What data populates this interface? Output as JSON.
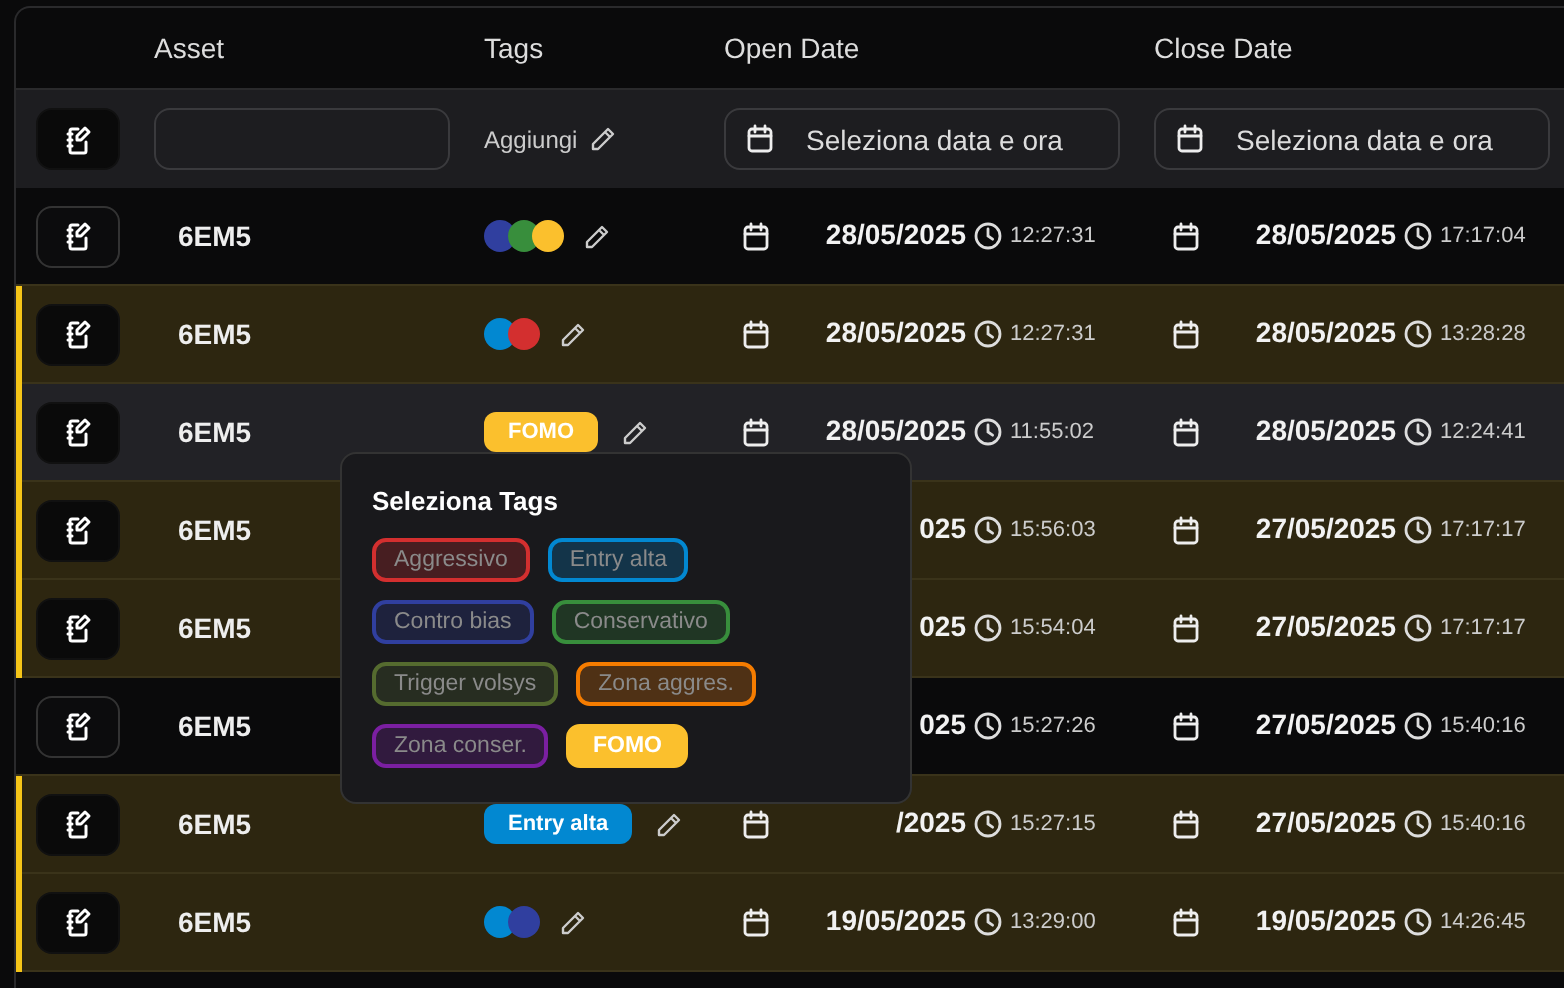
{
  "columns": [
    "Asset",
    "Tags",
    "Open Date",
    "Close Date"
  ],
  "filters": {
    "tags_label": "Aggiungi",
    "open_placeholder": "Seleziona data e ora",
    "close_placeholder": "Seleziona data e ora"
  },
  "rows": [
    {
      "asset": "6EM5",
      "highlighted": false,
      "hovered": false,
      "tags": [
        {
          "kind": "dot",
          "color": "#303f9f"
        },
        {
          "kind": "dot",
          "color": "#388e3c"
        },
        {
          "kind": "dot",
          "color": "#fbc02d"
        }
      ],
      "open_date": "28/05/2025",
      "open_time": "12:27:31",
      "close_date": "28/05/2025",
      "close_time": "17:17:04"
    },
    {
      "asset": "6EM5",
      "highlighted": true,
      "hovered": false,
      "tags": [
        {
          "kind": "dot",
          "color": "#0288d1"
        },
        {
          "kind": "dot",
          "color": "#d32f2f"
        }
      ],
      "open_date": "28/05/2025",
      "open_time": "12:27:31",
      "close_date": "28/05/2025",
      "close_time": "13:28:28"
    },
    {
      "asset": "6EM5",
      "highlighted": true,
      "hovered": true,
      "tags": [
        {
          "kind": "chip",
          "label": "FOMO",
          "color": "#fbc02d"
        }
      ],
      "open_date": "28/05/2025",
      "open_time": "11:55:02",
      "close_date": "28/05/2025",
      "close_time": "12:24:41"
    },
    {
      "asset": "6EM5",
      "highlighted": true,
      "hovered": false,
      "open_date": "025",
      "open_time": "15:56:03",
      "close_date": "27/05/2025",
      "close_time": "17:17:17"
    },
    {
      "asset": "6EM5",
      "highlighted": true,
      "hovered": false,
      "open_date": "025",
      "open_time": "15:54:04",
      "close_date": "27/05/2025",
      "close_time": "17:17:17"
    },
    {
      "asset": "6EM5",
      "highlighted": false,
      "hovered": false,
      "open_date": "025",
      "open_time": "15:27:26",
      "close_date": "27/05/2025",
      "close_time": "15:40:16"
    },
    {
      "asset": "6EM5",
      "highlighted": true,
      "hovered": false,
      "tags": [
        {
          "kind": "chip",
          "label": "Entry alta",
          "color": "#0288d1"
        }
      ],
      "open_date": "/2025",
      "open_time": "15:27:15",
      "close_date": "27/05/2025",
      "close_time": "15:40:16"
    },
    {
      "asset": "6EM5",
      "highlighted": true,
      "hovered": false,
      "tags": [
        {
          "kind": "dot",
          "color": "#0288d1"
        },
        {
          "kind": "dot",
          "color": "#303f9f"
        }
      ],
      "open_date": "19/05/2025",
      "open_time": "13:29:00",
      "close_date": "19/05/2025",
      "close_time": "14:26:45"
    }
  ],
  "popover": {
    "title": "Seleziona Tags",
    "tags": [
      {
        "label": "Aggressivo",
        "color": "#d32f2f",
        "selected": false
      },
      {
        "label": "Entry alta",
        "color": "#0288d1",
        "selected": false
      },
      {
        "label": "Contro bias",
        "color": "#303f9f",
        "selected": false
      },
      {
        "label": "Conservativo",
        "color": "#388e3c",
        "selected": false
      },
      {
        "label": "Trigger volsys",
        "color": "#556b2f",
        "selected": false
      },
      {
        "label": "Zona aggres.",
        "color": "#f57c00",
        "selected": false
      },
      {
        "label": "Zona conser.",
        "color": "#7b1fa2",
        "selected": false
      },
      {
        "label": "FOMO",
        "color": "#fbc02d",
        "selected": true
      }
    ]
  }
}
